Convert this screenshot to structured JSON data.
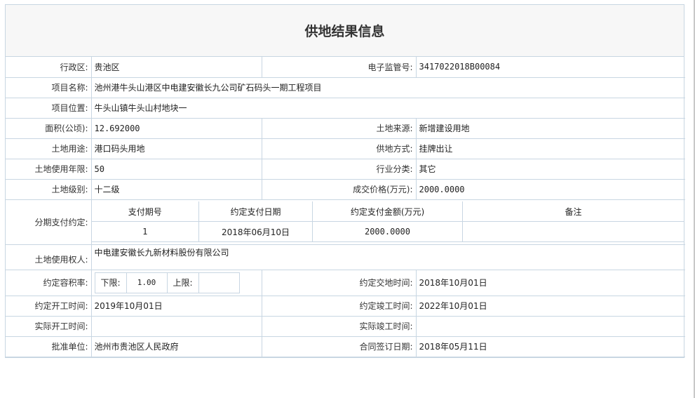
{
  "page_title": "供地结果信息",
  "rows": {
    "district_label": "行政区:",
    "district_value": "贵池区",
    "supervision_no_label": "电子监管号:",
    "supervision_no_value": "3417022018B00084",
    "project_name_label": "项目名称:",
    "project_name_value": "池州港牛头山港区中电建安徽长九公司矿石码头一期工程项目",
    "project_location_label": "项目位置:",
    "project_location_value": "牛头山镇牛头山村地块一",
    "area_label": "面积(公顷):",
    "area_value": "12.692000",
    "land_source_label": "土地来源:",
    "land_source_value": "新增建设用地",
    "land_use_label": "土地用途:",
    "land_use_value": "港口码头用地",
    "supply_method_label": "供地方式:",
    "supply_method_value": "挂牌出让",
    "use_years_label": "土地使用年限:",
    "use_years_value": "50",
    "industry_label": "行业分类:",
    "industry_value": "其它",
    "land_grade_label": "土地级别:",
    "land_grade_value": "十二级",
    "price_label": "成交价格(万元):",
    "price_value": "2000.0000",
    "installment_label": "分期支付约定:",
    "right_holder_label": "土地使用权人:",
    "right_holder_value": "中电建安徽长九新材料股份有限公司",
    "far_label": "约定容积率:",
    "far_lower_label": "下限:",
    "far_lower_value": "1.00",
    "far_upper_label": "上限:",
    "far_upper_value": "",
    "delivery_time_label": "约定交地时间:",
    "delivery_time_value": "2018年10月01日",
    "start_time_label": "约定开工时间:",
    "start_time_value": "2019年10月01日",
    "finish_time_label": "约定竣工时间:",
    "finish_time_value": "2022年10月01日",
    "actual_start_label": "实际开工时间:",
    "actual_start_value": "",
    "actual_finish_label": "实际竣工时间:",
    "actual_finish_value": "",
    "approver_label": "批准单位:",
    "approver_value": "池州市贵池区人民政府",
    "contract_date_label": "合同签订日期:",
    "contract_date_value": "2018年05月11日"
  },
  "installments": {
    "headers": [
      "支付期号",
      "约定支付日期",
      "约定支付金额(万元)",
      "备注"
    ],
    "rows": [
      {
        "period": "1",
        "date": "2018年06月10日",
        "amount": "2000.0000",
        "note": ""
      }
    ]
  }
}
